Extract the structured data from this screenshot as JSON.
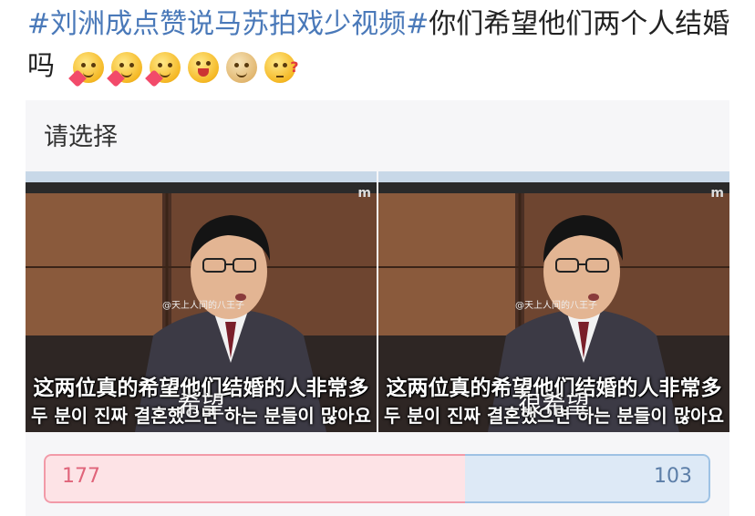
{
  "post": {
    "hashtag": "#刘洲成点赞说马苏拍戏少视频#",
    "text": "你们希望他们两个人结婚吗"
  },
  "emojis": [
    "heart-smile-icon",
    "heart-smile-icon",
    "heart-smile-icon",
    "cheer-icon",
    "doge-icon",
    "thinking-icon"
  ],
  "poll": {
    "title": "请选择",
    "options": [
      {
        "label": "希望",
        "votes": "177",
        "subtitle_cn": "这两位真的希望他们结婚的人非常多",
        "subtitle_kr": "두 분이 진짜 결혼했으면 하는 분들이 많아요",
        "watermark": "@天上人间的八王子",
        "channel_logo": "m"
      },
      {
        "label": "很希望",
        "votes": "103",
        "subtitle_cn": "这两位真的希望他们结婚的人非常多",
        "subtitle_kr": "두 분이 진짜 결혼했으면 하는 분들이 많아요",
        "watermark": "@天上人间的八王子",
        "channel_logo": "m"
      }
    ],
    "share_left": 0.632
  },
  "colors": {
    "hashtag": "#4a79b9",
    "vote_left": "#e0647a",
    "vote_right": "#5c7ea8"
  }
}
